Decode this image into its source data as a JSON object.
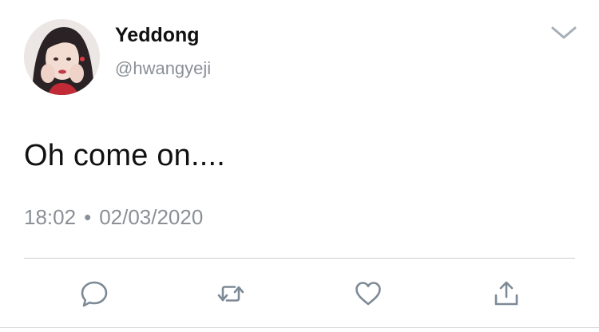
{
  "user": {
    "display_name": "Yeddong",
    "handle": "@hwangyeji",
    "avatar_icon": "profile-photo"
  },
  "tweet": {
    "text": "Oh come on....",
    "time": "18:02",
    "separator": "•",
    "date": "02/03/2020"
  },
  "actions": [
    {
      "name": "reply",
      "icon": "speech-bubble-icon"
    },
    {
      "name": "retweet",
      "icon": "retweet-icon"
    },
    {
      "name": "like",
      "icon": "heart-icon"
    },
    {
      "name": "share",
      "icon": "share-icon"
    }
  ],
  "colors": {
    "text": "#111111",
    "secondary": "#8a9096",
    "icon": "#7d8a96",
    "divider": "#c9cdd1"
  }
}
